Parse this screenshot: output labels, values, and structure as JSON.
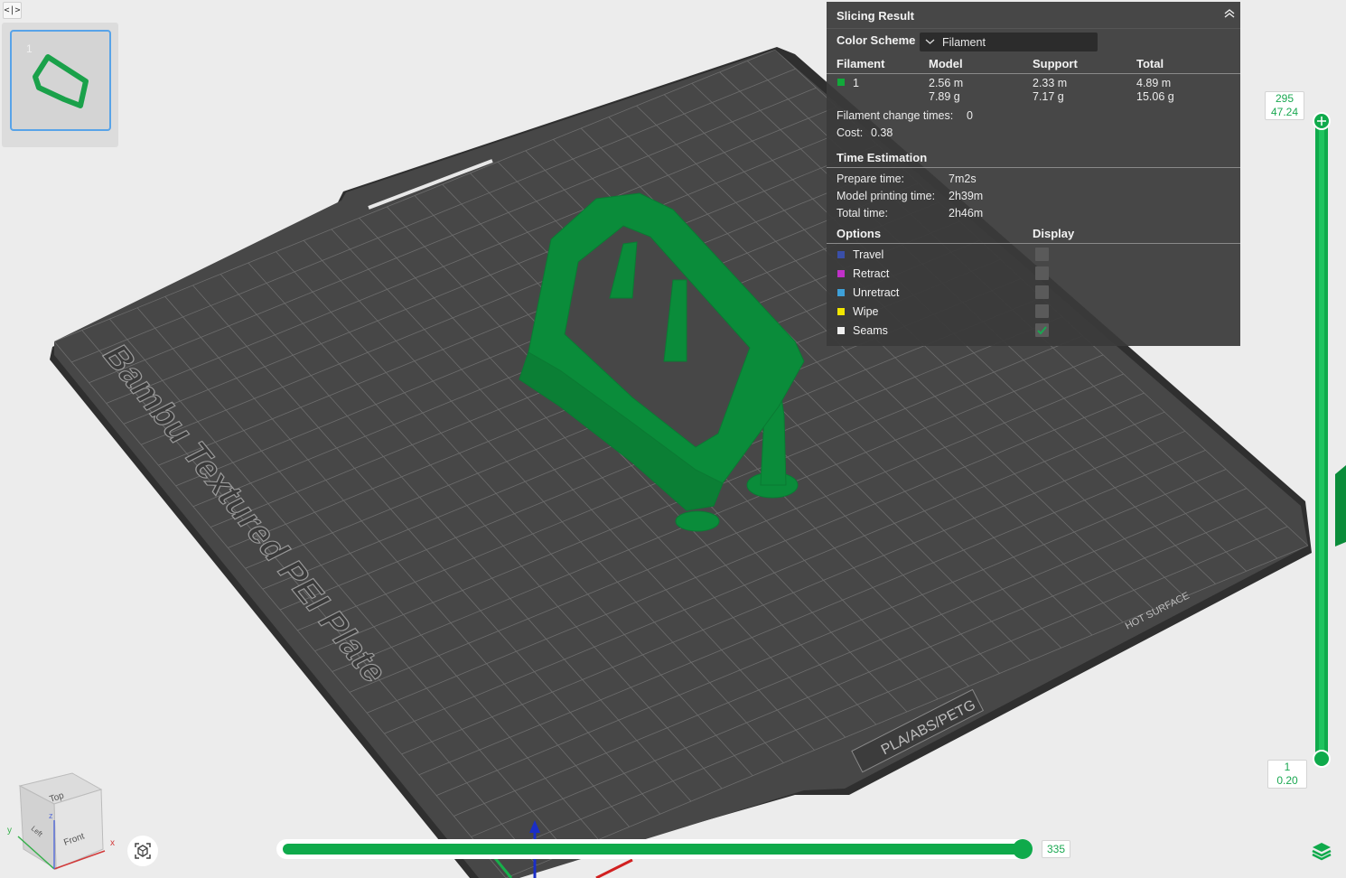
{
  "toolbar": {
    "collapse_icon": "code-toggle-icon"
  },
  "plates": [
    {
      "number": "1"
    }
  ],
  "build_plate": {
    "name": "Bambu Textured PEI Plate",
    "material_label": "PLA/ABS/PETG",
    "warning_label": "HOT SURFACE",
    "color": "#464646",
    "model_color": "#0a8c3a"
  },
  "slicing_result": {
    "title": "Slicing Result",
    "color_scheme_label": "Color Scheme",
    "color_scheme_value": "Filament",
    "columns": [
      "Filament",
      "Model",
      "Support",
      "Total"
    ],
    "filaments": [
      {
        "id": "1",
        "color": "#12a93a",
        "model_length": "2.56 m",
        "model_weight": "7.89 g",
        "support_length": "2.33 m",
        "support_weight": "7.17 g",
        "total_length": "4.89 m",
        "total_weight": "15.06 g"
      }
    ],
    "filament_change_label": "Filament change times:",
    "filament_change_value": "0",
    "cost_label": "Cost:",
    "cost_value": "0.38",
    "time_title": "Time Estimation",
    "prepare_label": "Prepare time:",
    "prepare_value": "7m2s",
    "model_print_label": "Model printing time:",
    "model_print_value": "2h39m",
    "total_time_label": "Total time:",
    "total_time_value": "2h46m",
    "options_title": "Options",
    "display_title": "Display",
    "options": [
      {
        "label": "Travel",
        "color": "#3a4fa8",
        "checked": false
      },
      {
        "label": "Retract",
        "color": "#c030c8",
        "checked": false
      },
      {
        "label": "Unretract",
        "color": "#3ea0d8",
        "checked": false
      },
      {
        "label": "Wipe",
        "color": "#f2e600",
        "checked": false
      },
      {
        "label": "Seams",
        "color": "#f0f0f0",
        "checked": true
      }
    ]
  },
  "layer_slider": {
    "top_layer": "295",
    "top_height": "47.24",
    "bottom_layer": "1",
    "bottom_height": "0.20"
  },
  "move_slider": {
    "value": "335"
  },
  "navcube": {
    "top": "Top",
    "front": "Front",
    "left": "Left",
    "x": "x",
    "y": "y",
    "z": "z"
  }
}
